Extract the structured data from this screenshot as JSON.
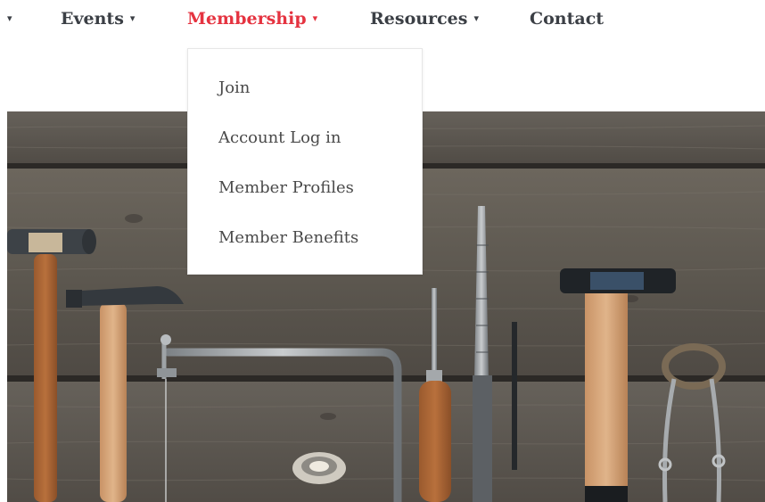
{
  "nav": {
    "items": [
      {
        "label": "Events",
        "caret": "▾"
      },
      {
        "label": "Membership",
        "caret": "▾"
      },
      {
        "label": "Resources",
        "caret": "▾"
      },
      {
        "label": "Contact"
      }
    ],
    "left_caret": "▾",
    "active_color": "#e53340",
    "text_color": "#3b3f45"
  },
  "dropdown": {
    "items": [
      {
        "label": "Join"
      },
      {
        "label": "Account Log in"
      },
      {
        "label": "Member Profiles"
      },
      {
        "label": "Member Benefits"
      }
    ]
  },
  "hero": {
    "image": "tools-on-wooden-boards",
    "wood_color": "#5f5a52"
  }
}
